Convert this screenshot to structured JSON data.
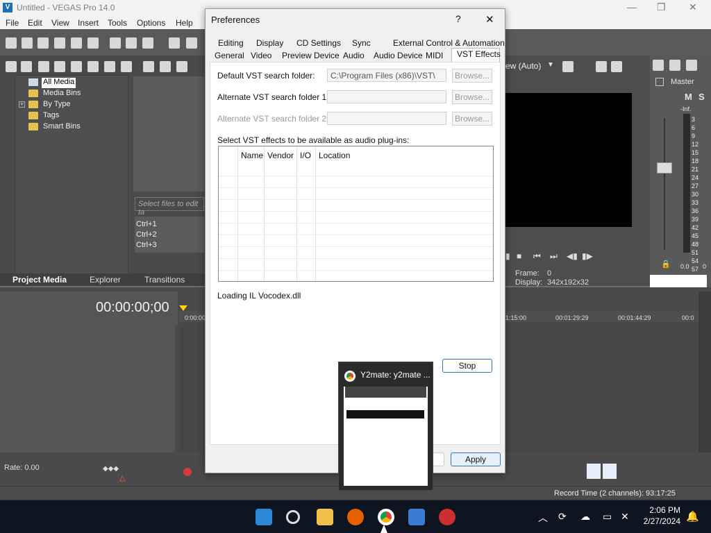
{
  "app": {
    "title": "Untitled - VEGAS Pro 14.0"
  },
  "menu": [
    "File",
    "Edit",
    "View",
    "Insert",
    "Tools",
    "Options",
    "Help"
  ],
  "explorer": {
    "tree": [
      "All Media",
      "Media Bins",
      "By Type",
      "Tags",
      "Smart Bins"
    ],
    "filter_placeholder": "Select files to edit ta",
    "hotkeys": [
      "Ctrl+1",
      "Ctrl+2",
      "Ctrl+3"
    ],
    "tabs": [
      "Project Media",
      "Explorer",
      "Transitions"
    ]
  },
  "preview": {
    "mode": "ew (Auto)",
    "frame_label": "Frame:",
    "frame_value": "0",
    "display_label": "Display:",
    "display_value": "342x192x32"
  },
  "master": {
    "label": "Master",
    "inf": "-Inf.",
    "scale": [
      "3",
      "6",
      "9",
      "12",
      "15",
      "18",
      "21",
      "24",
      "27",
      "30",
      "33",
      "36",
      "39",
      "42",
      "45",
      "48",
      "51",
      "54",
      "57"
    ],
    "level_left": "0.0",
    "level_right": "0"
  },
  "timeline": {
    "timecode": "00:00:00;00",
    "ruler": [
      "0:00:00",
      "1:15:00",
      "00:01:29:29",
      "00:01:44:29",
      "00:0"
    ],
    "rate": "Rate: 0.00"
  },
  "status": {
    "record_time": "Record Time (2 channels): 93:17:25"
  },
  "dialog": {
    "title": "Preferences",
    "help": "?",
    "close": "✕",
    "tabs_row1": [
      "Editing",
      "Display",
      "CD Settings",
      "Sync",
      "External Control & Automation"
    ],
    "tabs_row2": [
      "General",
      "Video",
      "Preview Device",
      "Audio",
      "Audio Device",
      "MIDI",
      "VST Effects"
    ],
    "default_label": "Default VST search folder:",
    "default_value": "C:\\Program Files (x86)\\VST\\",
    "alt1_label": "Alternate VST search folder 1:",
    "alt2_label": "Alternate VST search folder 2:",
    "browse": "Browse...",
    "list_label": "Select VST effects to be available as audio plug-ins:",
    "columns": [
      "Name",
      "Vendor",
      "I/O",
      "Location"
    ],
    "loading": "Loading IL Vocodex.dll",
    "stop": "Stop",
    "apply": "Apply"
  },
  "thumbnail": {
    "title": "Y2mate: y2mate ..."
  },
  "taskbar": {
    "time": "2:06 PM",
    "date": "2/27/2024"
  },
  "colors": {
    "accent": "#0067c0",
    "vegas_bg": "#4a4a4a",
    "dialog_bg": "#f0f0f0"
  }
}
